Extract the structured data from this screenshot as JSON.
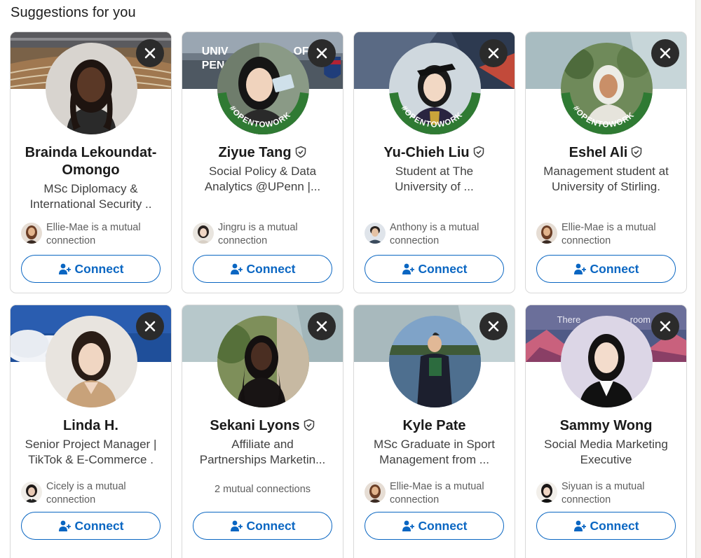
{
  "section_title": "Suggestions for you",
  "connect_label": "Connect",
  "colors": {
    "accent": "#0a66c2",
    "dismiss_bg": "#2b2b2b",
    "opentowork_green": "#2f7a33"
  },
  "cards": [
    {
      "name": "Brainda Lekoundat-",
      "name2": "Omongo",
      "verified": false,
      "headline1": "MSc Diplomacy &",
      "headline2": "International Security ..",
      "mutual": "Ellie-Mae is a mutual",
      "mutual2": "connection",
      "open_to_work": false,
      "icon": "profile-photo"
    },
    {
      "name": "Ziyue Tang",
      "verified": true,
      "headline1": "Social Policy & Data",
      "headline2": "Analytics @UPenn |...",
      "mutual": "Jingru is a mutual",
      "mutual2": "connection",
      "open_to_work": true,
      "opentowork_label": "#OPENTOWORK",
      "cover_text1": "UNIV",
      "cover_text2": "PEN",
      "cover_text3": "OF"
    },
    {
      "name": "Yu-Chieh Liu",
      "verified": true,
      "headline1": "Student at The",
      "headline2": "University of ...",
      "mutual": "Anthony is a mutual",
      "mutual2": "connection",
      "open_to_work": true,
      "opentowork_label": "#OPENTOWORK"
    },
    {
      "name": "Eshel Ali",
      "verified": true,
      "headline1": "Management student at",
      "headline2": "University of Stirling.",
      "mutual": "Ellie-Mae is a mutual",
      "mutual2": "connection",
      "open_to_work": true,
      "opentowork_label": "#OPENTOWORK"
    },
    {
      "name": "Linda H.",
      "verified": false,
      "headline1": "Senior Project Manager |",
      "headline2": "TikTok & E-Commerce .",
      "mutual": "Cicely is a mutual",
      "mutual2": "connection",
      "open_to_work": false
    },
    {
      "name": "Sekani Lyons",
      "verified": true,
      "headline1": "Affiliate and",
      "headline2": "Partnerships Marketin...",
      "mutual_count": "2 mutual connections",
      "open_to_work": false
    },
    {
      "name": "Kyle Pate",
      "verified": false,
      "headline1": "MSc Graduate in Sport",
      "headline2": "Management from ...",
      "mutual": "Ellie-Mae is a mutual",
      "mutual2": "connection",
      "open_to_work": false
    },
    {
      "name": "Sammy Wong",
      "verified": false,
      "headline1": "Social Media Marketing",
      "headline2": "Executive",
      "mutual": "Siyuan is a mutual",
      "mutual2": "connection",
      "open_to_work": false,
      "cover_text1": "There",
      "cover_text2": "room"
    }
  ]
}
